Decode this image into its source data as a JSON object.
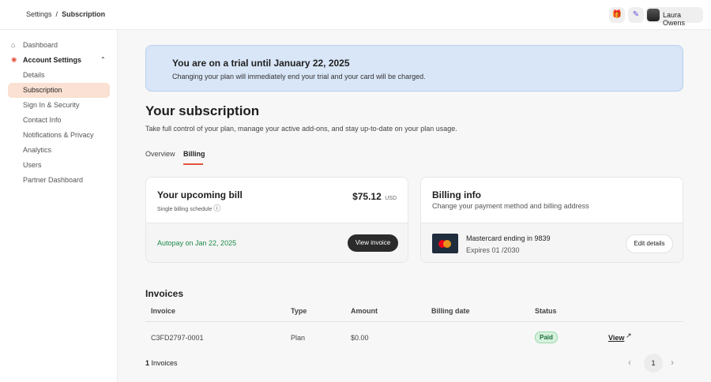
{
  "breadcrumb": {
    "parent": "Settings",
    "sep": "/",
    "current": "Subscription"
  },
  "header": {
    "user_name": "Laura Owens"
  },
  "sidebar": {
    "dashboard": "Dashboard",
    "account_settings": "Account Settings",
    "items": [
      "Details",
      "Subscription",
      "Sign In & Security",
      "Contact Info",
      "Notifications & Privacy",
      "Analytics",
      "Users",
      "Partner Dashboard"
    ]
  },
  "banner": {
    "title": "You are on a trial until January 22, 2025",
    "text": "Changing your plan will immediately end your trial and your card will be charged."
  },
  "page": {
    "title": "Your subscription",
    "subtitle": "Take full control of your plan, manage your active add-ons, and stay up-to-date on your plan usage.",
    "tabs": [
      "Overview",
      "Billing"
    ]
  },
  "bill": {
    "title": "Your upcoming bill",
    "schedule": "Single billing schedule",
    "amount": "$75.12",
    "currency": "USD",
    "autopay": "Autopay on Jan 22, 2025",
    "view_invoice": "View invoice"
  },
  "billing_info": {
    "title": "Billing info",
    "subtitle": "Change your payment method and billing address",
    "card": "Mastercard ending in 9839",
    "expires": "Expires 01 /2030",
    "edit": "Edit details"
  },
  "invoices": {
    "title": "Invoices",
    "headers": [
      "Invoice",
      "Type",
      "Amount",
      "Billing date",
      "Status"
    ],
    "rows": [
      {
        "id": "C3FD2797-0001",
        "type": "Plan",
        "amount": "$0.00",
        "date": "",
        "status": "Paid",
        "action": "View"
      }
    ],
    "count": "1",
    "count_label": "Invoices",
    "page": "1"
  },
  "colors": {
    "accent": "#e5533d",
    "green": "#1e8a4a"
  }
}
